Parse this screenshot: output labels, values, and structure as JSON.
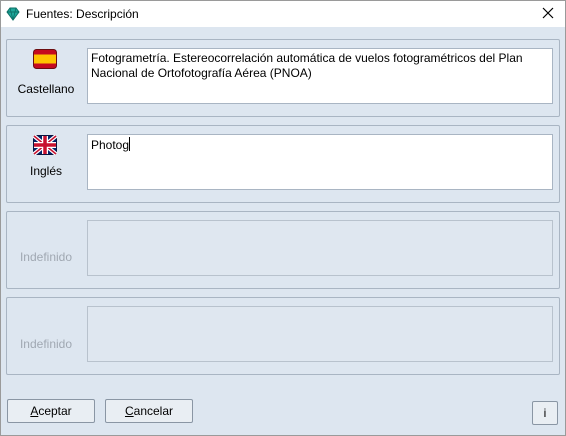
{
  "window": {
    "title": "Fuentes: Descripción"
  },
  "groups": [
    {
      "language": "Castellano",
      "flag": "spain-flag",
      "text": "Fotogrametría. Estereocorrelación automática de vuelos fotogramétricos del Plan\nNacional de Ortofotografía Aérea (PNOA)",
      "enabled": true
    },
    {
      "language": "Inglés",
      "flag": "uk-flag",
      "text": "Photog",
      "enabled": true
    },
    {
      "language": "Indefinido",
      "flag": "",
      "text": "",
      "enabled": false
    },
    {
      "language": "Indefinido",
      "flag": "",
      "text": "",
      "enabled": false
    }
  ],
  "buttons": {
    "accept": {
      "mnemonic": "A",
      "rest": "ceptar"
    },
    "cancel": {
      "mnemonic": "C",
      "rest": "ancelar"
    },
    "info": "i"
  }
}
